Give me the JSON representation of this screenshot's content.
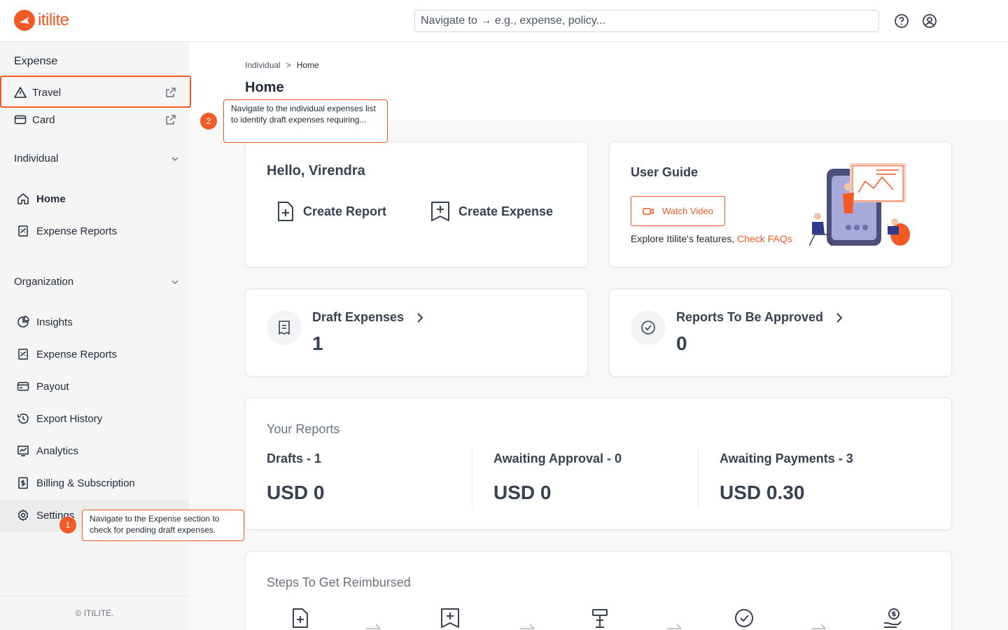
{
  "brand": {
    "name": "itilite",
    "color": "#f15a24"
  },
  "header": {
    "search_placeholder": "Navigate to → e.g., expense, policy...",
    "help_icon": "help-circle-icon",
    "profile_icon": "user-circle-icon"
  },
  "sidebar": {
    "expense_heading": "Expense",
    "expense_items": [
      {
        "label": "Travel",
        "icon": "warning-triangle-icon"
      },
      {
        "label": "Card",
        "icon": "card-icon"
      }
    ],
    "individual": {
      "label": "Individual",
      "items": [
        {
          "label": "Home",
          "icon": "home-icon"
        },
        {
          "label": "Expense Reports",
          "icon": "receipt-icon"
        }
      ]
    },
    "organization": {
      "label": "Organization",
      "items": [
        {
          "label": "Insights",
          "icon": "pie-chart-icon"
        },
        {
          "label": "Expense Reports",
          "icon": "receipt-icon"
        },
        {
          "label": "Payout",
          "icon": "card-icon"
        },
        {
          "label": "Export History",
          "icon": "history-icon"
        },
        {
          "label": "Analytics",
          "icon": "analytics-icon"
        },
        {
          "label": "Billing & Subscription",
          "icon": "billing-icon"
        },
        {
          "label": "Settings",
          "icon": "gear-icon"
        }
      ]
    },
    "footer": "© ITILITE."
  },
  "breadcrumb": {
    "parent": "Individual",
    "separator": ">",
    "current": "Home"
  },
  "page_title": "Home",
  "hello_card": {
    "greeting": "Hello, Virendra",
    "create_report": "Create Report",
    "create_expense": "Create Expense"
  },
  "guide_card": {
    "title": "User Guide",
    "watch_video": "Watch Video",
    "explore_text": "Explore Itilite's features,",
    "faq_link": "Check FAQs"
  },
  "draft_card": {
    "label": "Draft Expenses",
    "value": "1"
  },
  "approve_card": {
    "label": "Reports To Be Approved",
    "value": "0"
  },
  "reports": {
    "title": "Your Reports",
    "columns": [
      {
        "label": "Drafts - 1",
        "amount": "USD 0"
      },
      {
        "label": "Awaiting Approval - 0",
        "amount": "USD 0"
      },
      {
        "label": "Awaiting Payments - 3",
        "amount": "USD 0.30"
      }
    ]
  },
  "steps": {
    "title": "Steps To Get Reimbursed"
  },
  "annotations": {
    "tip1": {
      "number": "1",
      "text": "Navigate to the Expense section to check for pending draft expenses."
    },
    "tip2": {
      "number": "2",
      "text": "Navigate to the individual expenses list to identify draft expenses requiring..."
    }
  }
}
